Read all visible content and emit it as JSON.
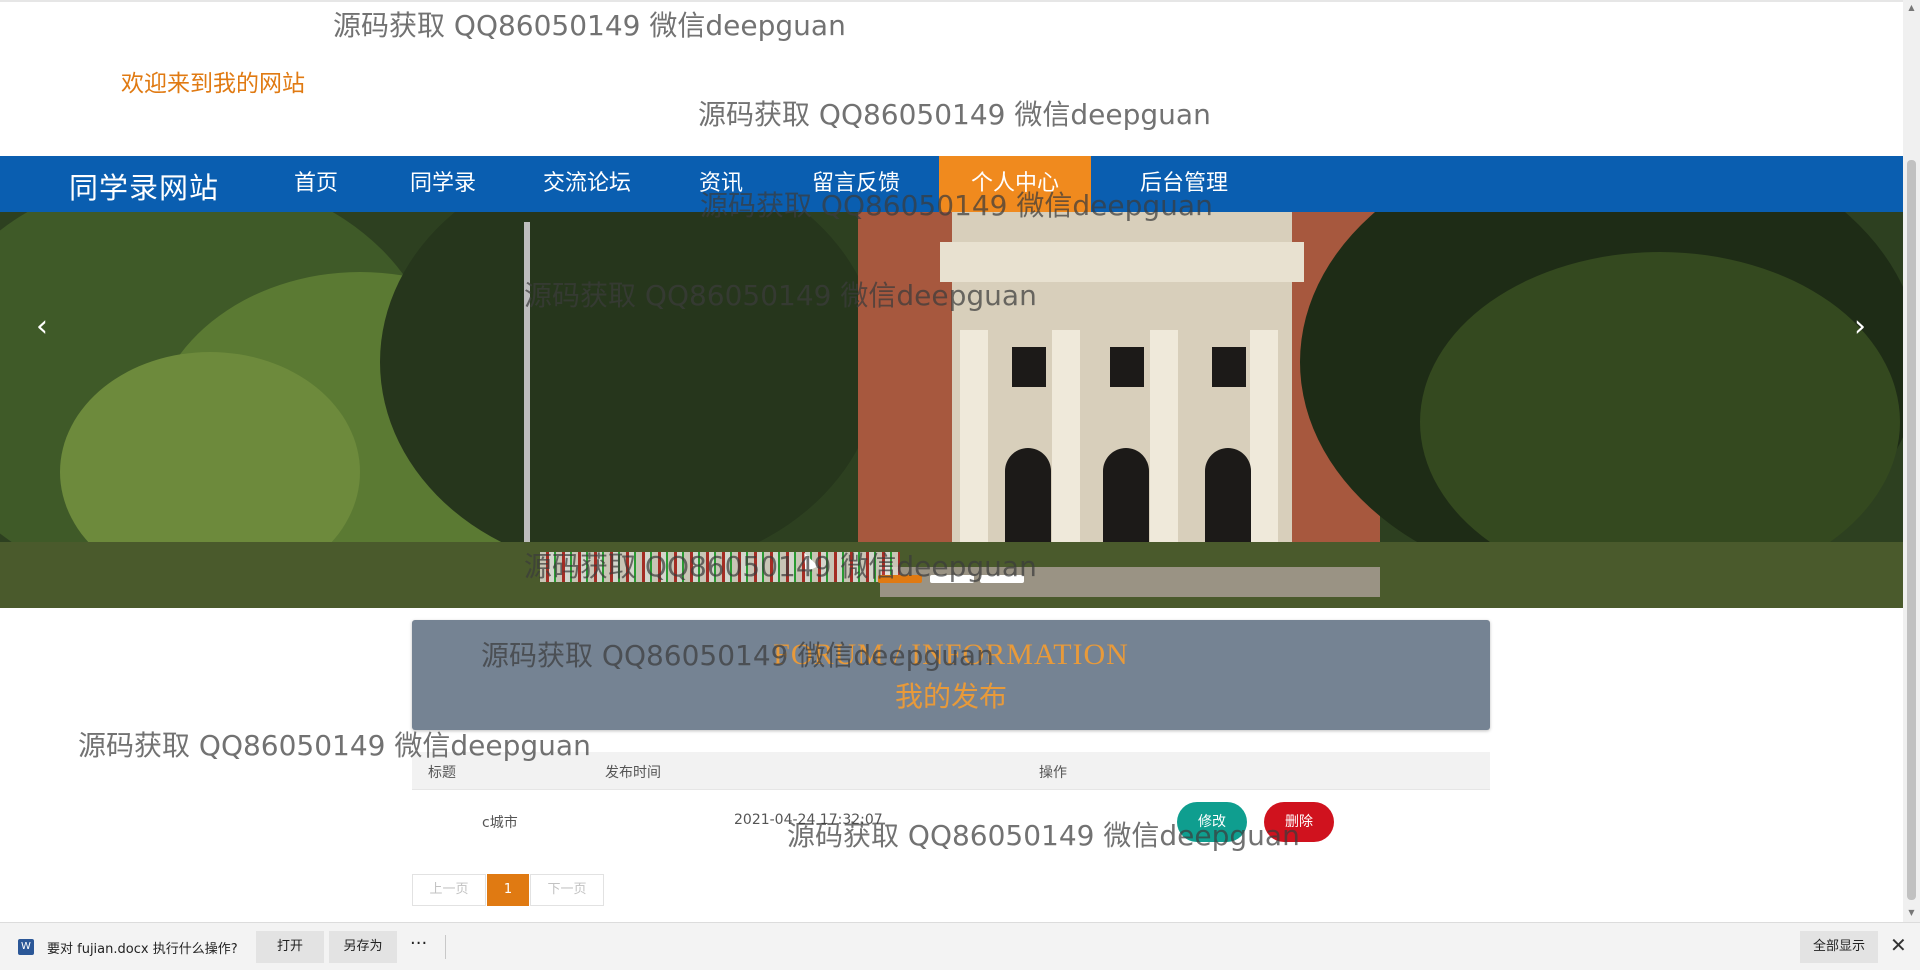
{
  "header": {
    "welcome": "欢迎来到我的网站"
  },
  "nav": {
    "brand": "同学录网站",
    "items": [
      {
        "label": "首页"
      },
      {
        "label": "同学录"
      },
      {
        "label": "交流论坛"
      },
      {
        "label": "资讯"
      },
      {
        "label": "留言反馈"
      },
      {
        "label": "个人中心",
        "active": true
      },
      {
        "label": "后台管理"
      }
    ]
  },
  "carousel": {
    "prev_icon": "chevron-left-icon",
    "next_icon": "chevron-right-icon",
    "prev_glyph": "‹",
    "next_glyph": "›",
    "active_index": 0,
    "indicator_count": 3
  },
  "forum": {
    "title_en": "FORUM / INFORMATION",
    "title_cn": "我的发布",
    "colors": {
      "banner": "#758393",
      "title": "#e89a3a"
    }
  },
  "table": {
    "columns": [
      "标题",
      "发布时间",
      "操作"
    ],
    "rows": [
      {
        "title": "c城市",
        "time": "2021-04-24 17:32:07",
        "edit": "修改",
        "delete": "删除"
      }
    ]
  },
  "pagination": {
    "prev": "上一页",
    "current": "1",
    "next": "下一页"
  },
  "download_bar": {
    "file_icon": "W",
    "prompt": "要对 fujian.docx 执行什么操作?",
    "open": "打开",
    "save_as": "另存为",
    "more": "···",
    "show_all": "全部显示",
    "close": "✕"
  },
  "watermark": {
    "text": "源码获取 QQ86050149 微信deepguan"
  },
  "colors": {
    "navbar": "#0a5eb0",
    "accent": "#f08a1e",
    "welcome": "#e07a12",
    "edit_button": "#0f9e8f",
    "delete_button": "#d0121e"
  }
}
